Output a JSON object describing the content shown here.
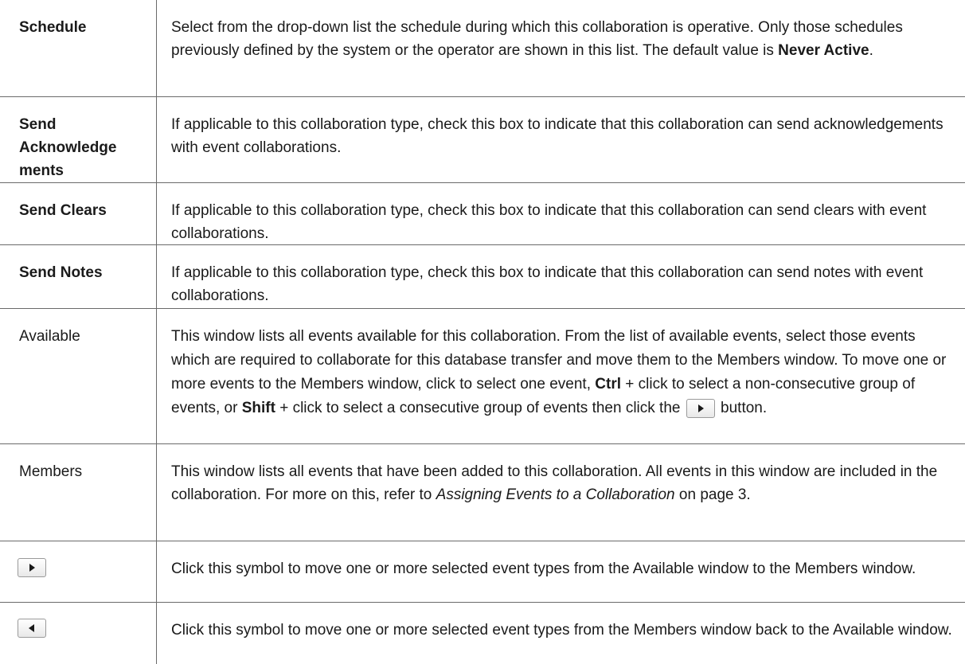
{
  "rows": [
    {
      "term": "Schedule",
      "desc_1": "Select from the drop-down list the schedule during which this collaboration is operative. Only those schedules previously defined by the system or the operator are shown in this list. The default value is ",
      "desc_bold": "Never Active",
      "desc_2": "."
    },
    {
      "term_1": "Send",
      "term_2": "Acknowledge",
      "term_3": "ments",
      "desc": "If applicable to this collaboration type, check this box to indicate that this collaboration can send acknowledgements with event collaborations."
    },
    {
      "term": "Send Clears",
      "desc": "If applicable to this collaboration type, check this box to indicate that this collaboration can send clears with event collaborations."
    },
    {
      "term": "Send Notes",
      "desc": "If applicable to this collaboration type, check this box to indicate that this collaboration can send notes with event collaborations."
    },
    {
      "term": "Available",
      "desc_1": "This window lists all events available for this collaboration. From the list of available events, select those events which are required to collaborate for this database transfer and move them to the Members window. To move one or more events to the Members window, click to select one event, ",
      "key_ctrl": "Ctrl",
      "desc_2": " + click to select a non-consecutive group of events, or ",
      "key_shift": "Shift",
      "desc_3": " + click to select a consecutive group of events then click the ",
      "desc_4": " button.",
      "button_icon": "right-arrow-icon"
    },
    {
      "term": "Members",
      "desc_1": "This window lists all events that have been added to this collaboration. All events in this window are included in the collaboration. For more on this, refer to ",
      "desc_link": "Assigning Events to a Collaboration",
      "desc_2": " on page 3."
    },
    {
      "term_icon": "right-arrow-icon",
      "desc": "Click this symbol to move one or more selected event types from the Available window to the Members window."
    },
    {
      "term_icon": "left-arrow-icon",
      "desc": "Click this symbol to move one or more selected event types from the Members window back to the Available window."
    }
  ]
}
